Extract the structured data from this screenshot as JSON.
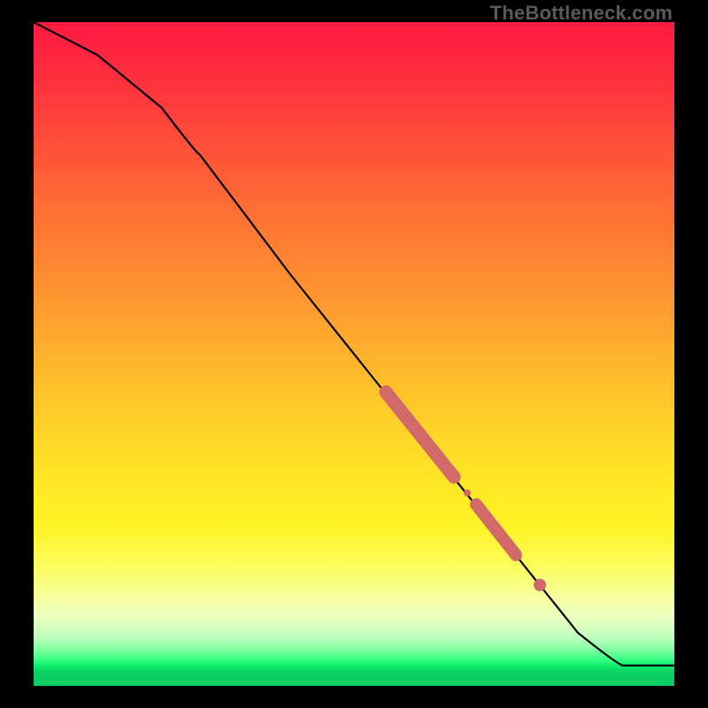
{
  "watermark": "TheBottleneck.com",
  "chart_data": {
    "type": "line",
    "title": "",
    "xlabel": "",
    "ylabel": "",
    "xlim": [
      0,
      100
    ],
    "ylim": [
      0,
      100
    ],
    "series": [
      {
        "name": "bottleneck-curve",
        "x": [
          0,
          10,
          20,
          26,
          40,
          55,
          70,
          85,
          92,
          100
        ],
        "y": [
          100,
          95,
          87,
          80,
          62,
          44,
          26,
          8,
          3,
          3
        ]
      }
    ],
    "markers": [
      {
        "name": "segment-a",
        "x_range": [
          55,
          65
        ],
        "y_range": [
          44,
          32
        ],
        "thickness": 9
      },
      {
        "name": "segment-b",
        "x_range": [
          69,
          75
        ],
        "y_range": [
          27,
          20
        ],
        "thickness": 9
      },
      {
        "name": "dot-c",
        "x": 79,
        "y": 15,
        "radius": 5
      }
    ],
    "colors": {
      "line": "#000000",
      "marker": "#d36a6a"
    }
  }
}
